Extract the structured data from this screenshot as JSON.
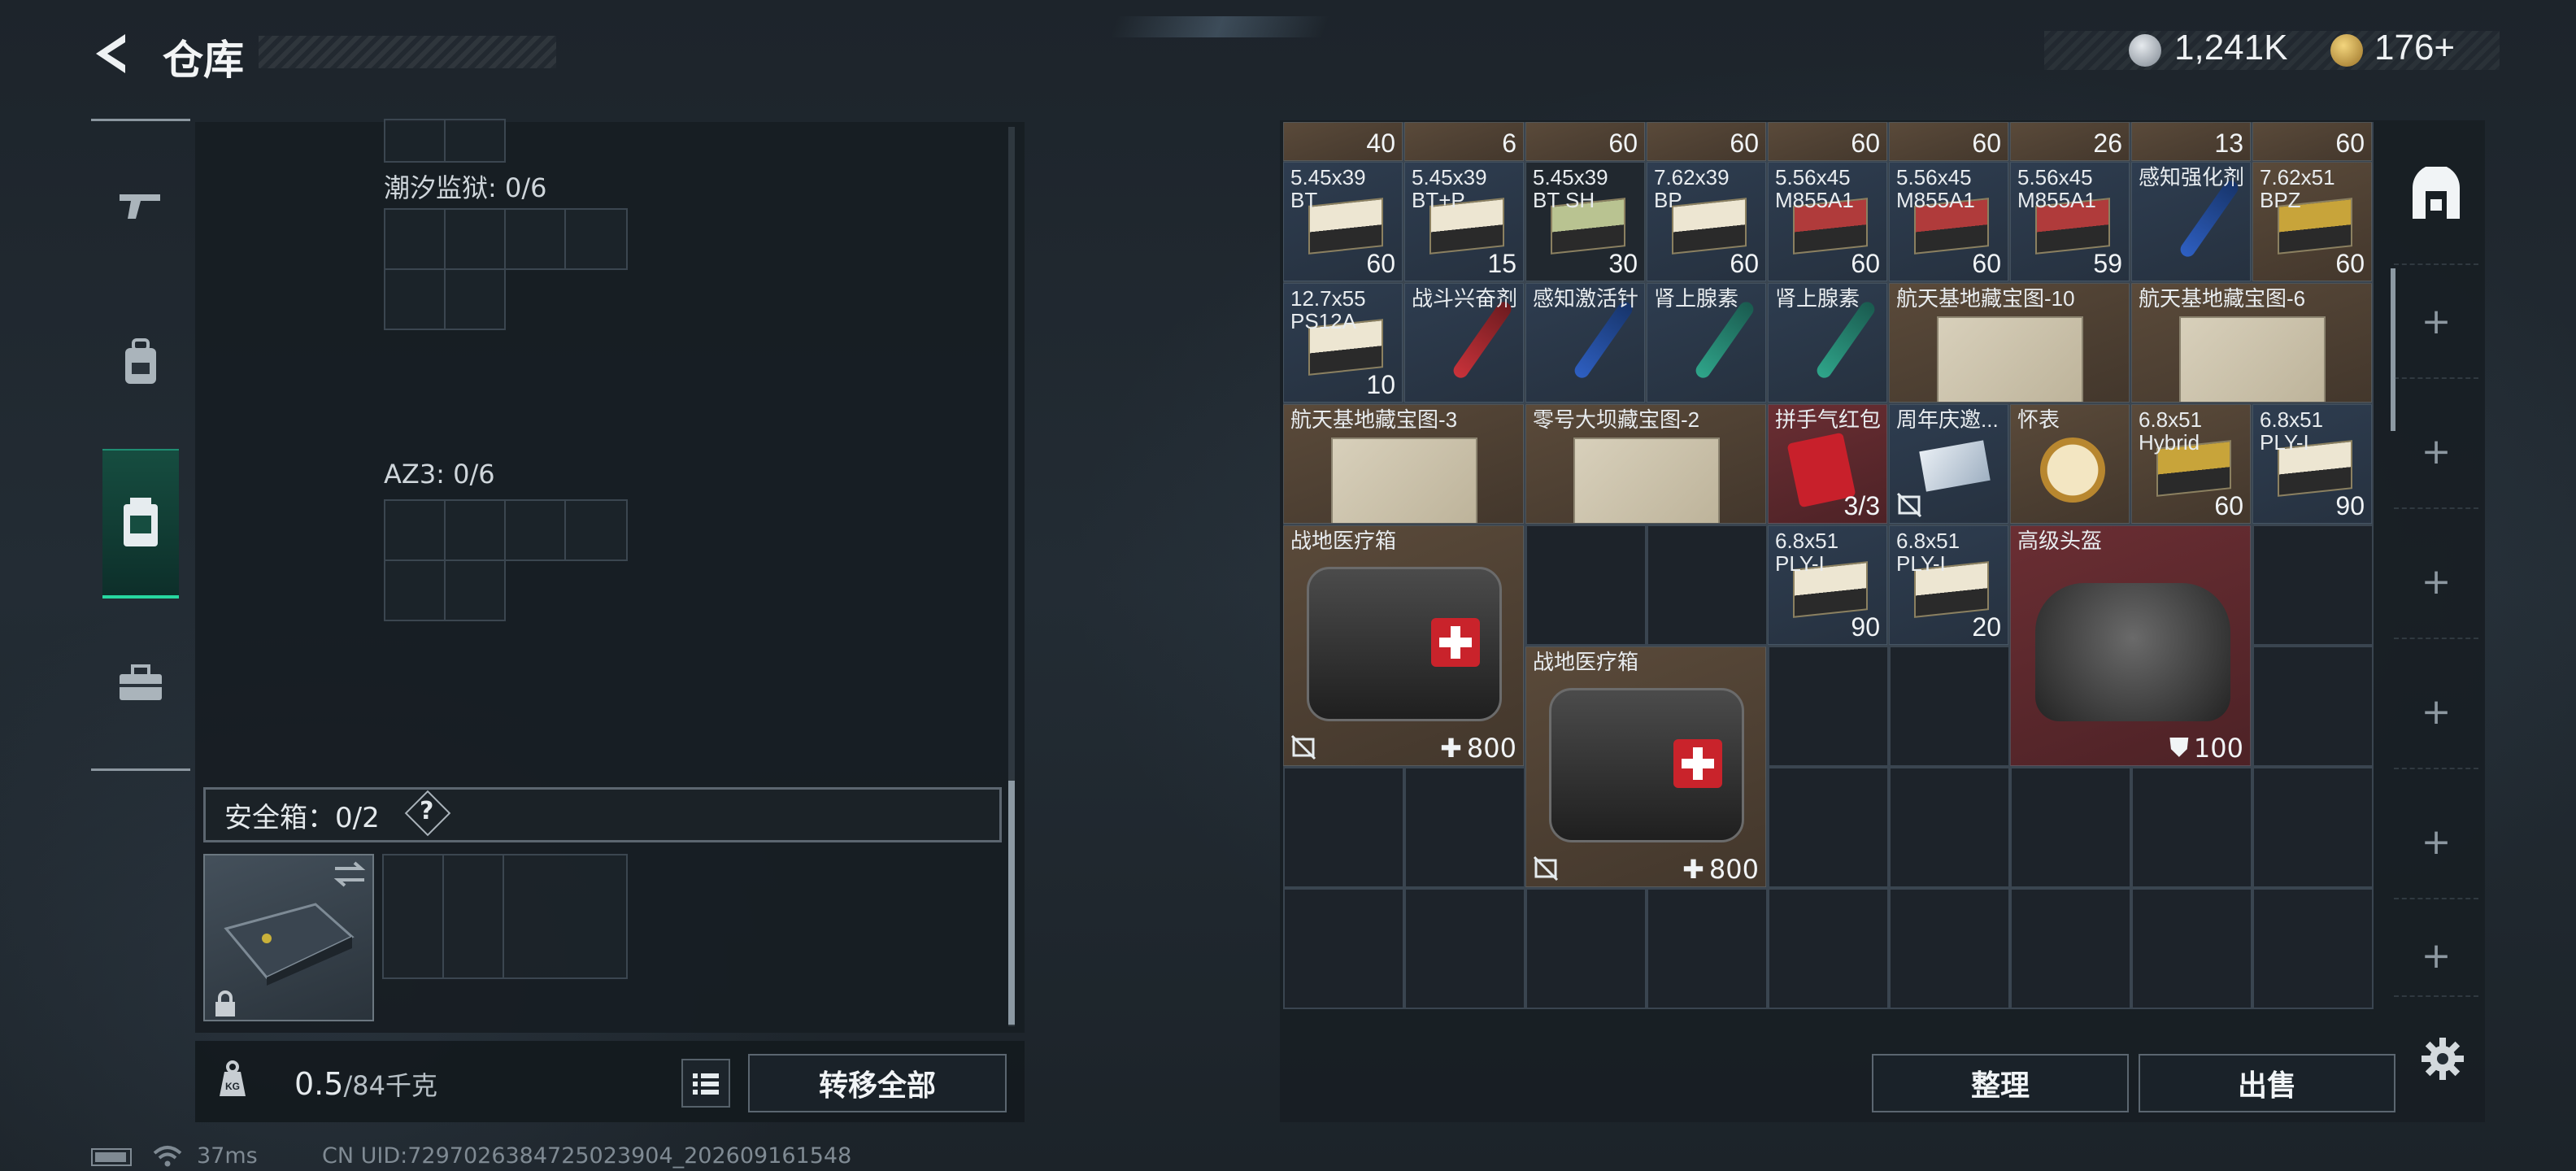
{
  "header": {
    "title": "仓库",
    "silver": "1,241K",
    "gold": "176+"
  },
  "left_nav": [
    {
      "icon": "gun-icon"
    },
    {
      "icon": "backpack-icon"
    },
    {
      "icon": "vest-icon",
      "active": true
    },
    {
      "icon": "toolbox-icon"
    }
  ],
  "containers": [
    {
      "label": "潮汐监狱: 0/6"
    },
    {
      "label": "AZ3: 0/6"
    }
  ],
  "safebox": {
    "label": "安全箱：0/2",
    "help": "?"
  },
  "footer_left": {
    "weight": "0.5",
    "weight_max": "/84千克",
    "transfer_all": "转移全部"
  },
  "stash": {
    "top_row_counts": [
      "40",
      "6",
      "60",
      "60",
      "60",
      "60",
      "26",
      "13",
      "60"
    ],
    "items": [
      {
        "name": "5.45x39\nBT",
        "count": "60",
        "bg": "blue",
        "art": "ammo"
      },
      {
        "name": "5.45x39\nBT+P",
        "count": "15",
        "bg": "blue",
        "art": "ammo"
      },
      {
        "name": "5.45x39\nBT SH",
        "count": "30",
        "bg": "dark",
        "art": "ammo-green"
      },
      {
        "name": "7.62x39\nBP",
        "count": "60",
        "bg": "blue",
        "art": "ammo"
      },
      {
        "name": "5.56x45\nM855A1",
        "count": "60",
        "bg": "blue",
        "art": "ammo-red"
      },
      {
        "name": "5.56x45\nM855A1",
        "count": "60",
        "bg": "blue",
        "art": "ammo-red"
      },
      {
        "name": "5.56x45\nM855A1",
        "count": "59",
        "bg": "blue",
        "art": "ammo-red"
      },
      {
        "name": "感知强化剂",
        "count": "",
        "bg": "blue",
        "art": "syringe-blue"
      },
      {
        "name": "7.62x51\nBPZ",
        "count": "60",
        "bg": "brown",
        "art": "ammo-gold"
      },
      {
        "name": "12.7x55\nPS12A",
        "count": "10",
        "bg": "blue",
        "art": "ammo"
      },
      {
        "name": "战斗兴奋剂",
        "count": "",
        "bg": "blue",
        "art": "syringe-red"
      },
      {
        "name": "感知激活针",
        "count": "",
        "bg": "blue",
        "art": "syringe-blue"
      },
      {
        "name": "肾上腺素",
        "count": "",
        "bg": "blue",
        "art": "syringe-teal"
      },
      {
        "name": "肾上腺素",
        "count": "",
        "bg": "blue",
        "art": "syringe-teal"
      },
      {
        "name": "航天基地藏宝图-10",
        "count": "",
        "bg": "brown",
        "art": "map"
      },
      {
        "name": "航天基地藏宝图-6",
        "count": "",
        "bg": "brown",
        "art": "map"
      },
      {
        "name": "航天基地藏宝图-3",
        "count": "",
        "bg": "brown",
        "art": "map"
      },
      {
        "name": "零号大坝藏宝图-2",
        "count": "",
        "bg": "brown",
        "art": "map"
      },
      {
        "name": "拼手气红包",
        "count": "3/3",
        "bg": "red",
        "art": "redpacket"
      },
      {
        "name": "周年庆邀...",
        "count": "",
        "bg": "blue",
        "art": "invite"
      },
      {
        "name": "怀表",
        "count": "",
        "bg": "brown",
        "art": "watch"
      },
      {
        "name": "6.8x51\nHybrid",
        "count": "60",
        "bg": "brown",
        "art": "ammo-gold"
      },
      {
        "name": "6.8x51\nPLY-I",
        "count": "90",
        "bg": "blue",
        "art": "ammo"
      },
      {
        "name": "战地医疗箱",
        "count": "800",
        "bg": "brown",
        "art": "medkit"
      },
      {
        "name": "6.8x51\nPLY-I",
        "count": "90",
        "bg": "blue",
        "art": "ammo"
      },
      {
        "name": "6.8x51\nPLY-I",
        "count": "20",
        "bg": "blue",
        "art": "ammo"
      },
      {
        "name": "高级头盔",
        "count": "100",
        "bg": "red",
        "art": "helmet"
      },
      {
        "name": "战地医疗箱",
        "count": "800",
        "bg": "brown",
        "art": "medkit"
      }
    ]
  },
  "right_sidebar": [
    "stash-tab-icon",
    "+",
    "+",
    "+",
    "+",
    "+",
    "+",
    "+"
  ],
  "footer_right": {
    "sort": "整理",
    "sell": "出售"
  },
  "status": {
    "ping": "37ms",
    "uid": "CN UID:7297026384725023904_202609161548"
  }
}
